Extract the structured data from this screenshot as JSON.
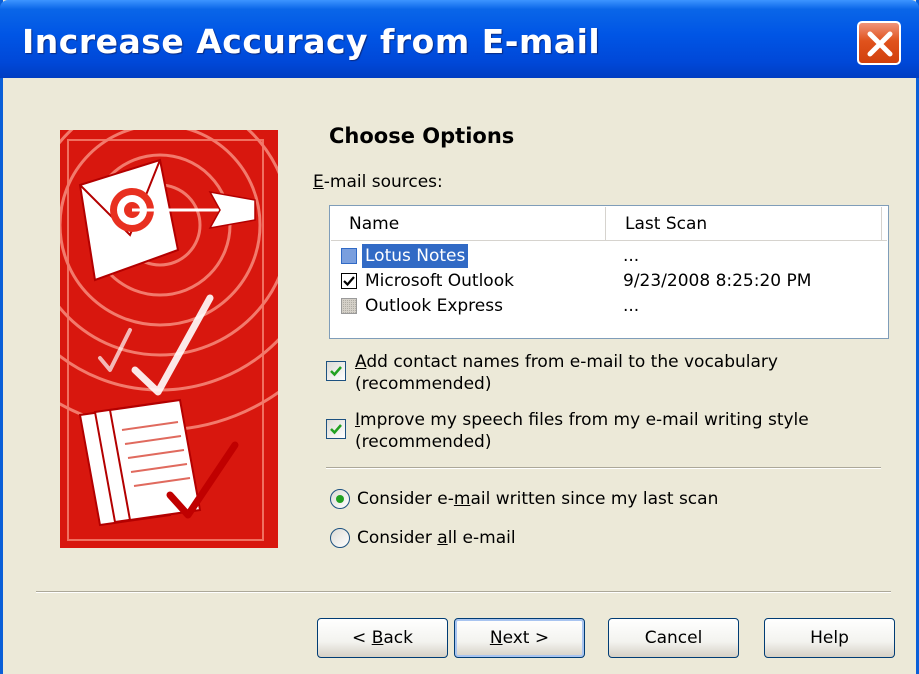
{
  "window": {
    "title": "Increase Accuracy from E-mail",
    "colors": {
      "titlebar": "#0055e5",
      "dialog_bg": "#ece9d8",
      "banner": "#d8170e",
      "selection": "#316ac5"
    }
  },
  "options": {
    "heading": "Choose Options",
    "sources_label_prefix": "E",
    "sources_label_rest": "-mail sources:"
  },
  "sources": {
    "columns": [
      "Name",
      "Last Scan"
    ],
    "rows": [
      {
        "name": "Lotus Notes",
        "last_scan": "...",
        "checked": false,
        "enabled": true,
        "selected": true
      },
      {
        "name": "Microsoft Outlook",
        "last_scan": "9/23/2008 8:25:20 PM",
        "checked": true,
        "enabled": true,
        "selected": false
      },
      {
        "name": "Outlook Express",
        "last_scan": "...",
        "checked": false,
        "enabled": false,
        "selected": false
      }
    ]
  },
  "checkboxes": [
    {
      "line1_prefix": "A",
      "line1_rest": "dd contact names from e-mail to the vocabulary",
      "line2": "(recommended)",
      "checked": true
    },
    {
      "line1_prefix": "I",
      "line1_rest": "mprove my speech files from my e-mail writing style",
      "line2": "(recommended)",
      "checked": true
    }
  ],
  "radios": [
    {
      "pre": "Consider e-",
      "accel": "m",
      "post": "ail written since my last scan",
      "selected": true
    },
    {
      "pre": "Consider ",
      "accel": "a",
      "post": "ll e-mail",
      "selected": false
    }
  ],
  "buttons": {
    "back": {
      "pre": "< ",
      "accel": "B",
      "post": "ack"
    },
    "next": {
      "pre": "",
      "accel": "N",
      "post": "ext >"
    },
    "cancel": "Cancel",
    "help": "Help"
  }
}
